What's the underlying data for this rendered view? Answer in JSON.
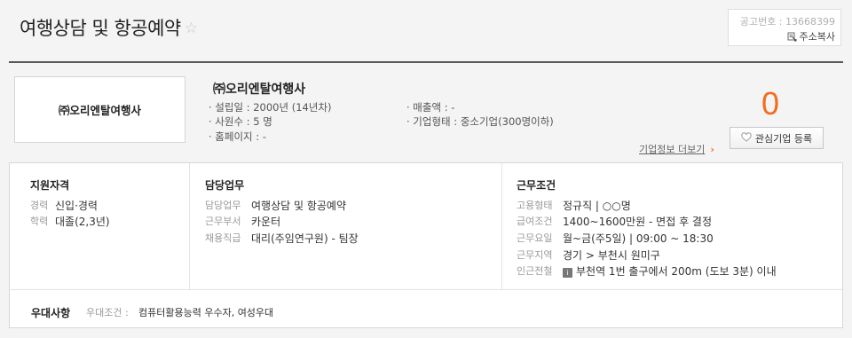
{
  "header": {
    "title": "여행상담 및 항공예약",
    "star": "☆",
    "notice_number": "공고번호 : 13668399",
    "address_copy": "주소복사"
  },
  "company": {
    "logo_text": "㈜오리엔탈여행사",
    "name": "㈜오리엔탈여행사",
    "founded": "· 설립일    : 2000년 (14년차)",
    "employees": "· 사원수    : 5 명",
    "homepage": "· 홈페이지 : -",
    "sales": "· 매출액     : -",
    "company_type": "· 기업형태 : 중소기업(300명이하)",
    "favorite_count": "0",
    "more_info": "기업정보 더보기",
    "favorite_button": "관심기업 등록"
  },
  "qualification": {
    "title": "지원자격",
    "rows": [
      {
        "label": "경력",
        "value": "신입·경력"
      },
      {
        "label": "학력",
        "value": "대졸(2,3년)"
      }
    ]
  },
  "duties": {
    "title": "담당업무",
    "rows": [
      {
        "label": "담당업무",
        "value": "여행상담 및 항공예약"
      },
      {
        "label": "근무부서",
        "value": "카운터"
      },
      {
        "label": "채용직급",
        "value": "대리(주임연구원) - 팀장"
      }
    ]
  },
  "conditions": {
    "title": "근무조건",
    "rows": [
      {
        "label": "고용형태",
        "value": "정규직  |  ○○명"
      },
      {
        "label": "급여조건",
        "value": "1400~1600만원 - 면접 후 결정"
      },
      {
        "label": "근무요일",
        "value": "월~금(주5일) | 09:00 ~ 18:30"
      },
      {
        "label": "근무지역",
        "value": "경기 > 부천시 원미구"
      },
      {
        "label": "인근전철",
        "value": "부천역 1번 출구에서 200m (도보 3분) 이내"
      }
    ]
  },
  "perks": {
    "title": "우대사항",
    "label": "우대조건 :",
    "value": "컴퓨터활용능력 우수자, 여성우대"
  },
  "colors": {
    "accent": "#f26d1f",
    "divider": "#5a5a5a"
  }
}
